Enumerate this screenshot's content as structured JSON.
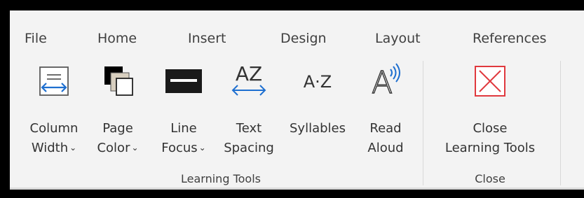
{
  "tabs": [
    "File",
    "Home",
    "Insert",
    "Design",
    "Layout",
    "References"
  ],
  "buttons": {
    "column_width": {
      "line1": "Column",
      "line2": "Width",
      "icon": "column-width-icon"
    },
    "page_color": {
      "line1": "Page",
      "line2": "Color",
      "icon": "page-color-icon"
    },
    "line_focus": {
      "line1": "Line",
      "line2": "Focus",
      "icon": "line-focus-icon"
    },
    "text_spacing": {
      "line1": "Text",
      "line2": "Spacing",
      "icon": "text-spacing-icon",
      "glyph": "AZ"
    },
    "syllables": {
      "line1": "Syllables",
      "icon": "syllables-icon",
      "glyph": "A·Z"
    },
    "read_aloud": {
      "line1": "Read",
      "line2": "Aloud",
      "icon": "read-aloud-icon",
      "glyph": "A"
    },
    "close_learning_tools": {
      "line1": "Close",
      "line2": "Learning Tools",
      "icon": "close-icon"
    }
  },
  "groups": {
    "learning_tools": "Learning Tools",
    "close": "Close"
  },
  "chevron": "⌄",
  "colors": {
    "accent_blue": "#1e6fd0",
    "close_red": "#e0393e",
    "background": "#f3f3f3"
  }
}
